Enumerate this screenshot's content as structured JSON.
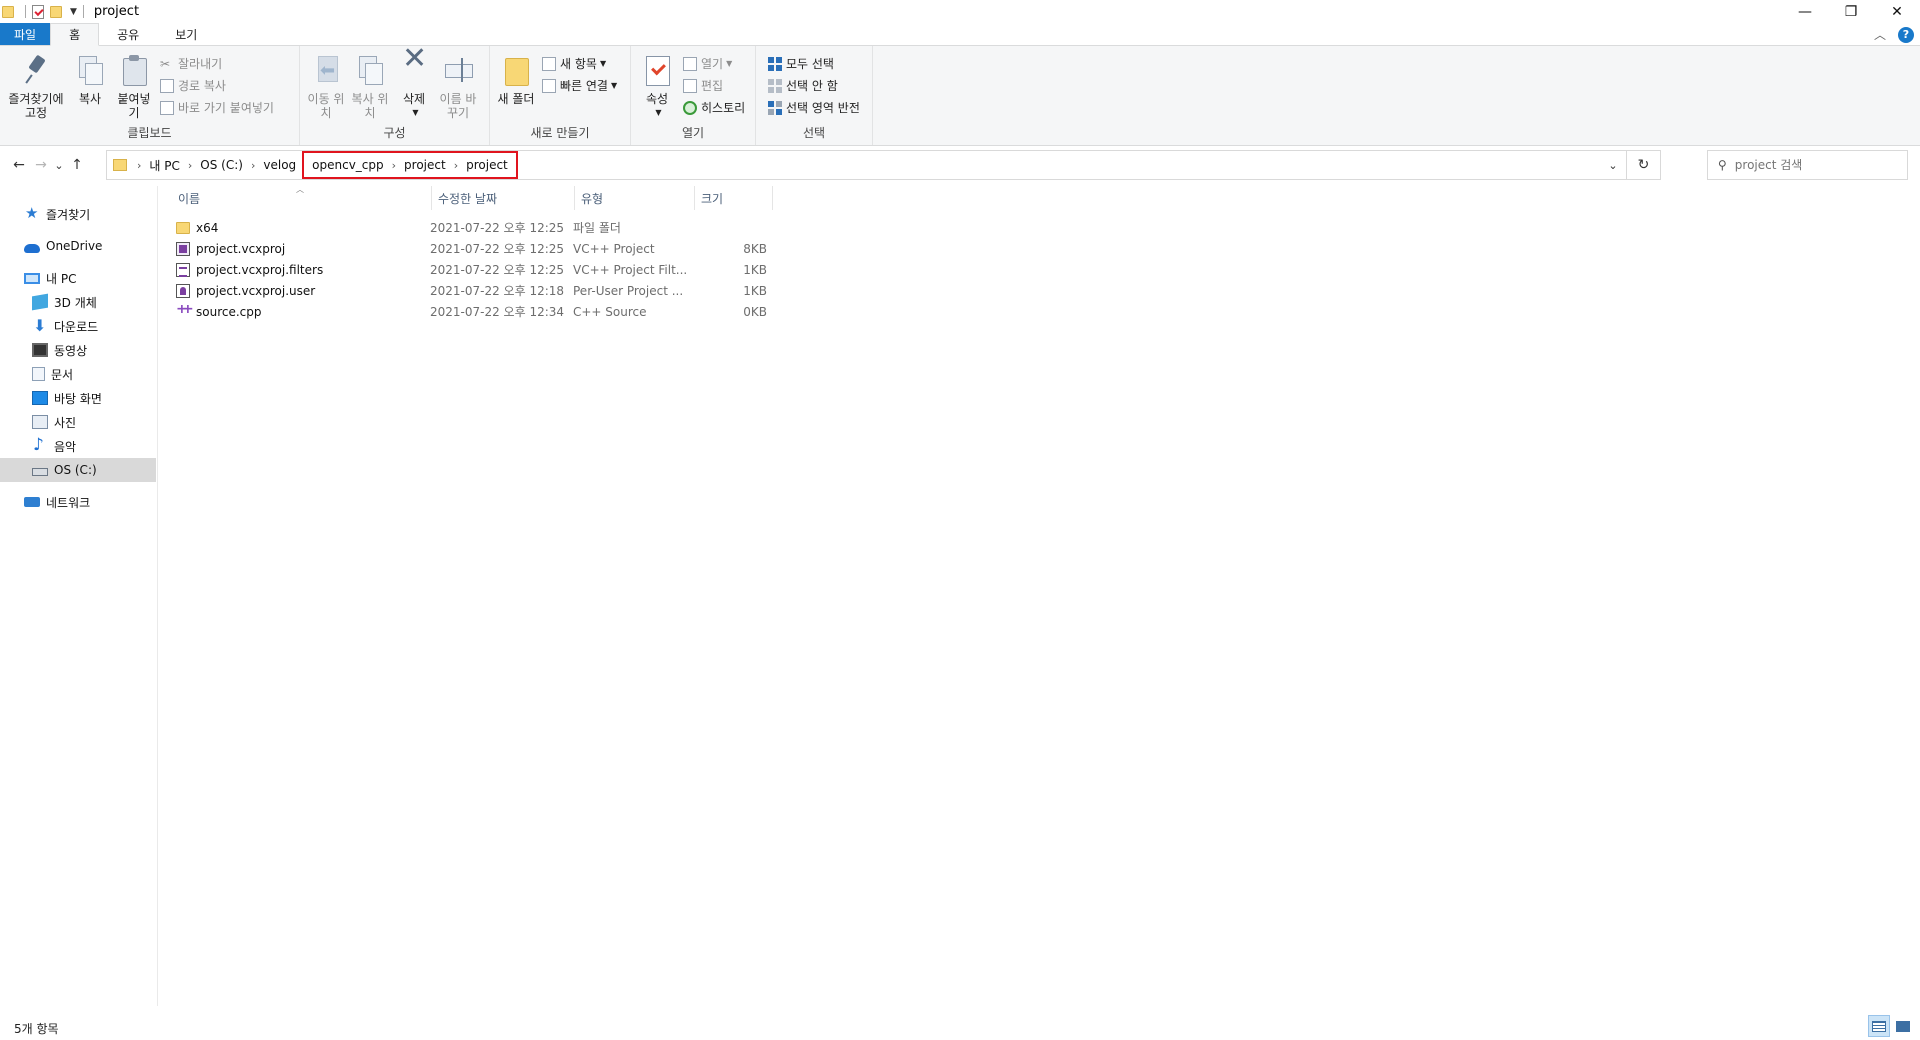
{
  "window": {
    "title": "project",
    "buttons": {
      "minimize": "—",
      "restore": "❐",
      "close": "✕"
    }
  },
  "ribbon_tabs": [
    "파일",
    "홈",
    "공유",
    "보기"
  ],
  "help": "?",
  "ribbon": {
    "clipboard": {
      "label": "클립보드",
      "pin": "즐겨찾기에 고정",
      "copy": "복사",
      "paste": "붙여넣기",
      "cut": "잘라내기",
      "copy_path": "경로 복사",
      "paste_shortcut": "바로 가기 붙여넣기"
    },
    "organize": {
      "label": "구성",
      "move_to": "이동 위치",
      "copy_to": "복사 위치",
      "delete": "삭제",
      "rename": "이름 바꾸기"
    },
    "new": {
      "label": "새로 만들기",
      "new_folder": "새 폴더",
      "new_item": "새 항목",
      "easy_access": "빠른 연결"
    },
    "open": {
      "label": "열기",
      "properties": "속성",
      "open": "열기",
      "edit": "편집",
      "history": "히스토리"
    },
    "select": {
      "label": "선택",
      "select_all": "모두 선택",
      "select_none": "선택 안 함",
      "invert": "선택 영역 반전"
    }
  },
  "nav": {
    "back": "←",
    "forward": "→",
    "recent": "⌄",
    "up": "↑"
  },
  "address": {
    "crumbs_plain": [
      "내 PC",
      "OS (C:)",
      "velog"
    ],
    "crumbs_highlighted": [
      "opencv_cpp",
      "project",
      "project"
    ],
    "separator": "›",
    "highlight_color": "#e0141e"
  },
  "search": {
    "placeholder": "project 검색"
  },
  "nav_pane": {
    "quick_access": "즐겨찾기",
    "onedrive": "OneDrive",
    "this_pc": "내 PC",
    "objects3d": "3D 개체",
    "downloads": "다운로드",
    "videos": "동영상",
    "documents": "문서",
    "desktop": "바탕 화면",
    "pictures": "사진",
    "music": "음악",
    "drive_c": "OS (C:)",
    "network": "네트워크"
  },
  "columns": {
    "name": "이름",
    "date": "수정한 날짜",
    "type": "유형",
    "size": "크기"
  },
  "files": [
    {
      "name": "x64",
      "date": "2021-07-22 오후 12:25",
      "type": "파일 폴더",
      "size": "",
      "icon": "folder-icon"
    },
    {
      "name": "project.vcxproj",
      "date": "2021-07-22 오후 12:25",
      "type": "VC++ Project",
      "size": "8KB",
      "icon": "vcxproj-icon"
    },
    {
      "name": "project.vcxproj.filters",
      "date": "2021-07-22 오후 12:25",
      "type": "VC++ Project Filt...",
      "size": "1KB",
      "icon": "filters-icon"
    },
    {
      "name": "project.vcxproj.user",
      "date": "2021-07-22 오후 12:18",
      "type": "Per-User Project ...",
      "size": "1KB",
      "icon": "user-file-icon"
    },
    {
      "name": "source.cpp",
      "date": "2021-07-22 오후 12:34",
      "type": "C++ Source",
      "size": "0KB",
      "icon": "cpp-icon"
    }
  ],
  "status": {
    "item_count": "5개 항목"
  },
  "colors": {
    "accent": "#1979ca",
    "selected_nav": "#d9d9d9"
  }
}
